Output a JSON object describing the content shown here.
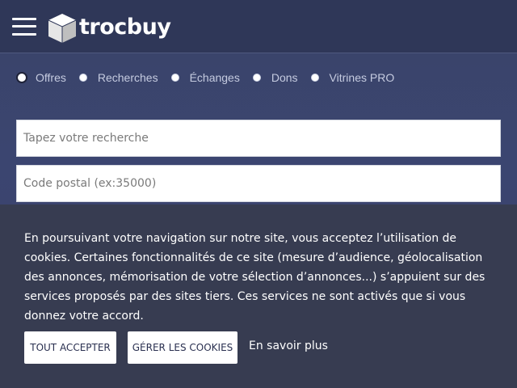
{
  "header": {
    "logo_text": "trocbuy"
  },
  "filters": [
    {
      "label": "Offres",
      "selected": true
    },
    {
      "label": "Recherches",
      "selected": false
    },
    {
      "label": "Échanges",
      "selected": false
    },
    {
      "label": "Dons",
      "selected": false
    },
    {
      "label": "Vitrines PRO",
      "selected": false
    }
  ],
  "search": {
    "placeholder": "Tapez votre recherche",
    "value": ""
  },
  "postal": {
    "placeholder": "Code postal (ex:35000)",
    "value": ""
  },
  "cookies": {
    "text": "En poursuivant votre navigation sur notre site, vous acceptez l’utilisation de cookies. Certaines fonctionnalités de ce site (mesure d’audience, géolocalisation des annonces, mémorisation de votre sélection d’annonces...) s’appuient sur des services proposés par des sites tiers. Ces services ne sont activés que si vous donnez votre accord.",
    "accept_label": "Tout accepter",
    "manage_label": "Gérer les cookies",
    "learn_more_label": "En savoir plus"
  },
  "colors": {
    "header_bg": "#2f3758",
    "page_bg": "#3a4468",
    "banner_bg": "#373c51"
  }
}
